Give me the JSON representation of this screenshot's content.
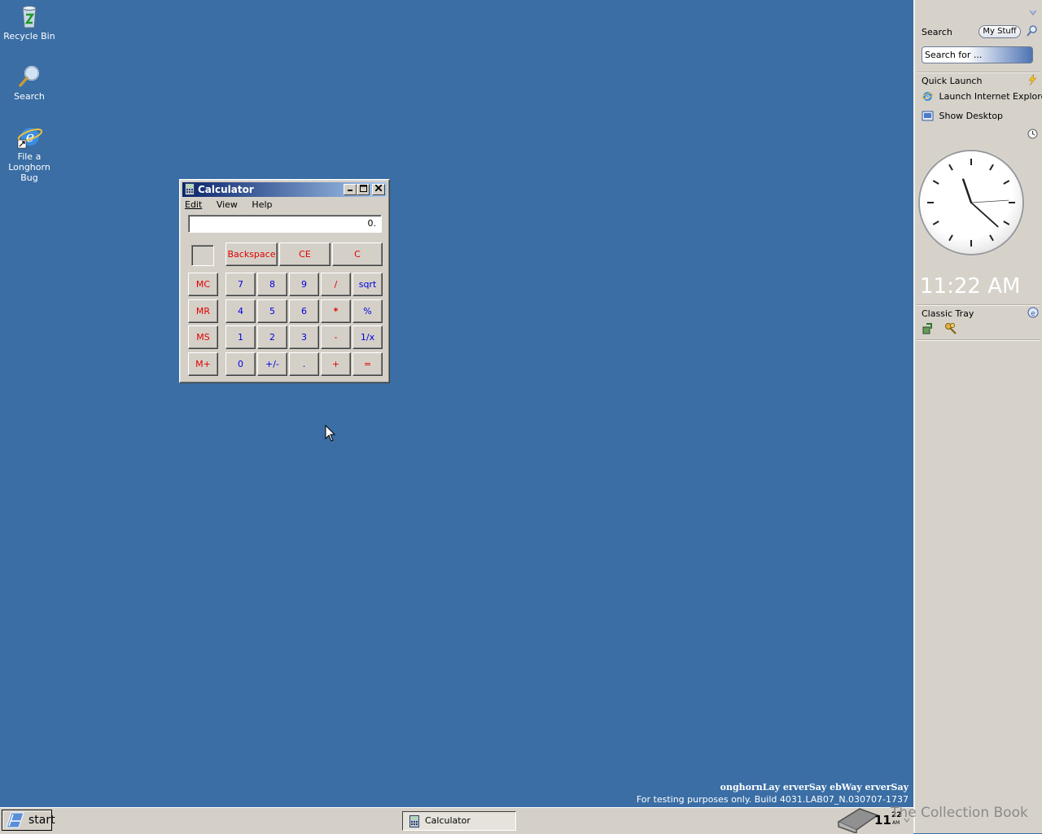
{
  "desktop": {
    "icons": [
      {
        "label": "Recycle Bin",
        "icon": "recycle-bin-icon"
      },
      {
        "label": "Search",
        "icon": "magnifier-icon"
      },
      {
        "label": "File a\nLonghorn Bug",
        "icon": "internet-explorer-icon"
      }
    ],
    "watermark_line1": "onghornLay erverSay ebWay erverSay",
    "watermark_line2": "For testing purposes only. Build 4031.LAB07_N.030707-1737",
    "overlay_text": "The Collection Book"
  },
  "calculator": {
    "title": "Calculator",
    "menu": [
      "Edit",
      "View",
      "Help"
    ],
    "display": "0.",
    "buttons": {
      "backspace": "Backspace",
      "ce": "CE",
      "c": "C",
      "mc": "MC",
      "mr": "MR",
      "ms": "MS",
      "mplus": "M+",
      "d7": "7",
      "d8": "8",
      "d9": "9",
      "div": "/",
      "sqrt": "sqrt",
      "d4": "4",
      "d5": "5",
      "d6": "6",
      "mul": "*",
      "pct": "%",
      "d1": "1",
      "d2": "2",
      "d3": "3",
      "sub": "-",
      "inv": "1/x",
      "d0": "0",
      "sign": "+/-",
      "dot": ".",
      "add": "+",
      "eq": "="
    }
  },
  "sidebar": {
    "search_label": "Search",
    "mystuff_label": "My Stuff",
    "search_placeholder": "Search for ...",
    "quick_launch_title": "Quick Launch",
    "quick_launch_items": [
      "Launch Internet Explorer",
      "Show Desktop"
    ],
    "clock_time": "11:22 AM",
    "classic_tray_title": "Classic Tray"
  },
  "taskbar": {
    "start_label": "start",
    "tasks": [
      "Calculator"
    ],
    "tray_time_hour": "11",
    "tray_time_min": "22",
    "tray_time_ampm": "AM"
  },
  "colors": {
    "desktop": "#3a6ea5",
    "calc_red": "#e00000",
    "calc_blue": "#0000e0"
  }
}
